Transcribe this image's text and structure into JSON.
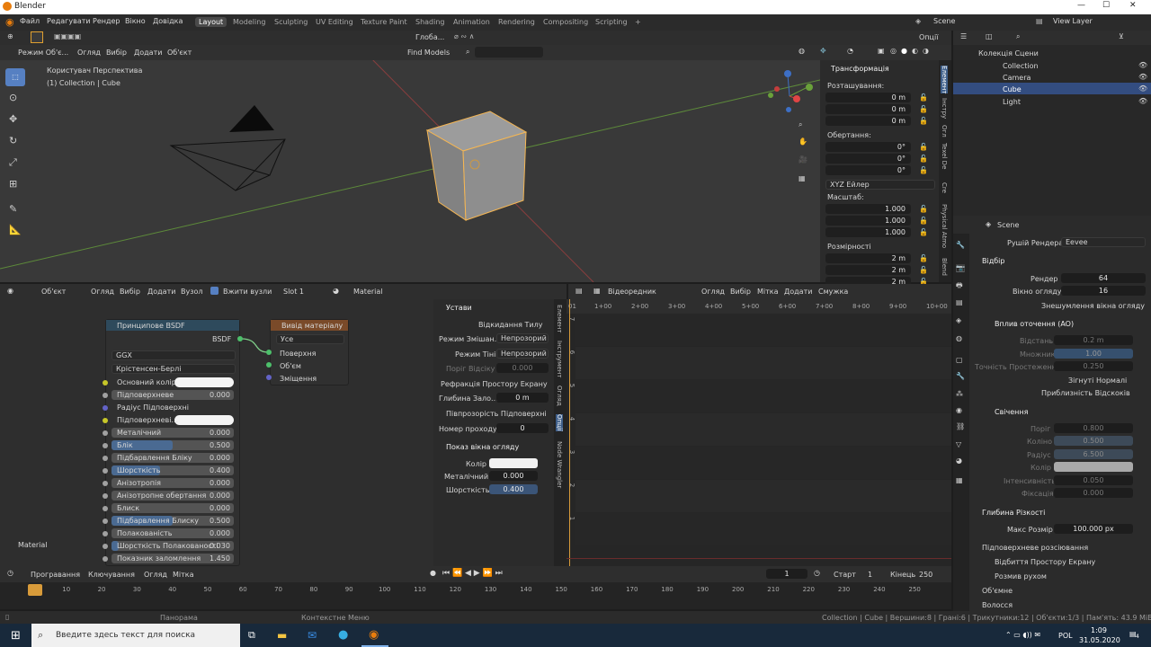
{
  "window": {
    "title": "Blender",
    "blender_icon": "blender-icon"
  },
  "menu": {
    "items": [
      "Файл",
      "Редагувати",
      "Рендер",
      "Вікно",
      "Довідка"
    ],
    "workspaces": [
      "Layout",
      "Modeling",
      "Sculpting",
      "UV Editing",
      "Texture Paint",
      "Shading",
      "Animation",
      "Rendering",
      "Compositing",
      "Scripting"
    ],
    "add_tab": "+",
    "scene": "Scene",
    "view_layer": "View Layer"
  },
  "viewport": {
    "mode": "Режим Об'є...",
    "menus": [
      "Огляд",
      "Вибір",
      "Додати",
      "Об'єкт"
    ],
    "orientation": "Глоба...",
    "find_models": "Find Models",
    "options": "Опції",
    "info_line1": "Користувач Перспектива",
    "info_line2": "(1) Collection | Cube"
  },
  "npanel": {
    "title": "Трансформація",
    "location_label": "Розташування:",
    "location": [
      [
        "X",
        "0 m"
      ],
      [
        "Y",
        "0 m"
      ],
      [
        "Z",
        "0 m"
      ]
    ],
    "rotation_label": "Обертання:",
    "rotation": [
      [
        "X",
        "0°"
      ],
      [
        "Y",
        "0°"
      ],
      [
        "Z",
        "0°"
      ]
    ],
    "rot_mode": "XYZ Ейлер",
    "scale_label": "Масштаб:",
    "scale": [
      [
        "X",
        "1.000"
      ],
      [
        "Y",
        "1.000"
      ],
      [
        "Z",
        "1.000"
      ]
    ],
    "dims_label": "Розмірності",
    "dims": [
      [
        "X",
        "2 m"
      ],
      [
        "Y",
        "2 m"
      ],
      [
        "Z",
        "2 m"
      ]
    ],
    "tabs": [
      "Елемент",
      "Інстру",
      "Огл",
      "Texel De",
      "Cre",
      "Physical Atmo",
      "Blend"
    ]
  },
  "outliner": {
    "root": "Колекція Сцени",
    "collection": "Collection",
    "items": [
      "Camera",
      "Cube",
      "Light"
    ]
  },
  "props": {
    "scene": "Scene",
    "engine_label": "Рушій Рендера",
    "engine": "Eevee",
    "sampling": "Відбір",
    "render_label": "Рендер",
    "render_val": "64",
    "viewport_label": "Вікно огляду",
    "viewport_val": "16",
    "denoise": "Знешумлення вікна огляду",
    "ao": "Вплив оточення (AO)",
    "ao_dist_label": "Відстань",
    "ao_dist": "0.2 m",
    "ao_factor_label": "Множник",
    "ao_factor": "1.00",
    "ao_trace_label": "Точність Простеження",
    "ao_trace": "0.250",
    "bent_normals": "Зігнуті Нормалі",
    "bounce_approx": "Приблизність Відскоків",
    "bloom": "Свічення",
    "bloom_thr_label": "Поріг",
    "bloom_thr": "0.800",
    "bloom_knee_label": "Коліно",
    "bloom_knee": "0.500",
    "bloom_radius_label": "Радіус",
    "bloom_radius": "6.500",
    "bloom_color_label": "Колір",
    "bloom_int_label": "Інтенсивність",
    "bloom_int": "0.050",
    "bloom_clamp_label": "Фіксація",
    "bloom_clamp": "0.000",
    "dof": "Глибина Різкості",
    "dof_max_label": "Макс Розмір",
    "dof_max": "100.000 px",
    "collapsed": [
      "Підповерхневе розсіювання",
      "Відбиття Простору Екрану",
      "Розмив рухом",
      "Об'ємне",
      "Волосся"
    ]
  },
  "nodeeditor": {
    "type": "Об'єкт",
    "menus": [
      "Огляд",
      "Вибір",
      "Додати",
      "Вузол"
    ],
    "use_nodes": "Вжити вузли",
    "slot": "Slot 1",
    "material": "Material",
    "footer": "Material",
    "bsdf_title": "Принципове BSDF",
    "bsdf_out": "BSDF",
    "dist": "GGX",
    "sss_method": "Крістенсен-Берлі",
    "inputs": [
      [
        "Основний колір",
        ""
      ],
      [
        "Підповерхневе",
        "0.000"
      ],
      [
        "Радіус Підповерхні",
        ""
      ],
      [
        "Підповерхневі...",
        ""
      ],
      [
        "Металічний",
        "0.000"
      ],
      [
        "Блік",
        "0.500"
      ],
      [
        "Підбарвлення Бліку",
        "0.000"
      ],
      [
        "Шорсткість",
        "0.400"
      ],
      [
        "Анізотропія",
        "0.000"
      ],
      [
        "Анізотропне обертання",
        "0.000"
      ],
      [
        "Блиск",
        "0.000"
      ],
      [
        "Підбарвлення Блиску",
        "0.500"
      ],
      [
        "Полакованість",
        "0.000"
      ],
      [
        "Шорсткість Полакованості",
        "0.030"
      ],
      [
        "Показник заломлення",
        "1.450"
      ]
    ],
    "out_title": "Вивід матеріалу",
    "out_target": "Усе",
    "out_sockets": [
      "Поверхня",
      "Об'єм",
      "Зміщення"
    ]
  },
  "nodeside": {
    "settings": "Устави",
    "backface": "Відкидання Тилу",
    "blend_label": "Режим Змішан...",
    "blend": "Непрозорий",
    "shadow_label": "Режим Тіні",
    "shadow": "Непрозорий",
    "clip_label": "Поріг Відсіку",
    "clip": "0.000",
    "ssr": "Рефракція Простору Екрану",
    "depth_label": "Глибина Зало...",
    "depth": "0 m",
    "sss_trans": "Півпрозорість Підповерхні",
    "pass_label": "Номер проходу",
    "pass": "0",
    "vp_display": "Показ вікна огляду",
    "color_label": "Колір",
    "metal_label": "Металічний",
    "metal": "0.000",
    "rough_label": "Шорсткість",
    "rough": "0.400",
    "tabs": [
      "Елемент",
      "Інструмент",
      "Огляд",
      "Опції",
      "Node Wrangler"
    ]
  },
  "sequencer": {
    "type": "Відеоредник",
    "menus": [
      "Огляд",
      "Вибір",
      "Мітка",
      "Додати",
      "Смужка"
    ],
    "ticks": [
      "01",
      "1+00",
      "2+00",
      "3+00",
      "4+00",
      "5+00",
      "6+00",
      "7+00",
      "8+00",
      "9+00",
      "10+00"
    ],
    "channels": [
      "7",
      "6",
      "5",
      "4",
      "3",
      "2",
      "1"
    ]
  },
  "timeline": {
    "menus": [
      "Програвання",
      "Ключування",
      "Огляд",
      "Мітка"
    ],
    "current": "1",
    "start_label": "Старт",
    "start": "1",
    "end_label": "Кінець",
    "end": "250",
    "ticks": [
      "1",
      "10",
      "20",
      "30",
      "40",
      "50",
      "60",
      "70",
      "80",
      "90",
      "100",
      "110",
      "120",
      "130",
      "140",
      "150",
      "160",
      "170",
      "180",
      "190",
      "200",
      "210",
      "220",
      "230",
      "240",
      "250"
    ]
  },
  "status": {
    "pan": "Панорама",
    "ctx": "Контекстне Меню",
    "info": "Collection | Cube | Вершини:8 | Грані:6 | Трикутники:12 | Об'єкти:1/3 | Пам'ять: 43.9 MiB | v2.82.7"
  },
  "taskbar": {
    "search": "Введите здесь текст для поиска",
    "lang": "POL",
    "time": "1:09",
    "date": "31.05.2020",
    "notif": "4"
  }
}
